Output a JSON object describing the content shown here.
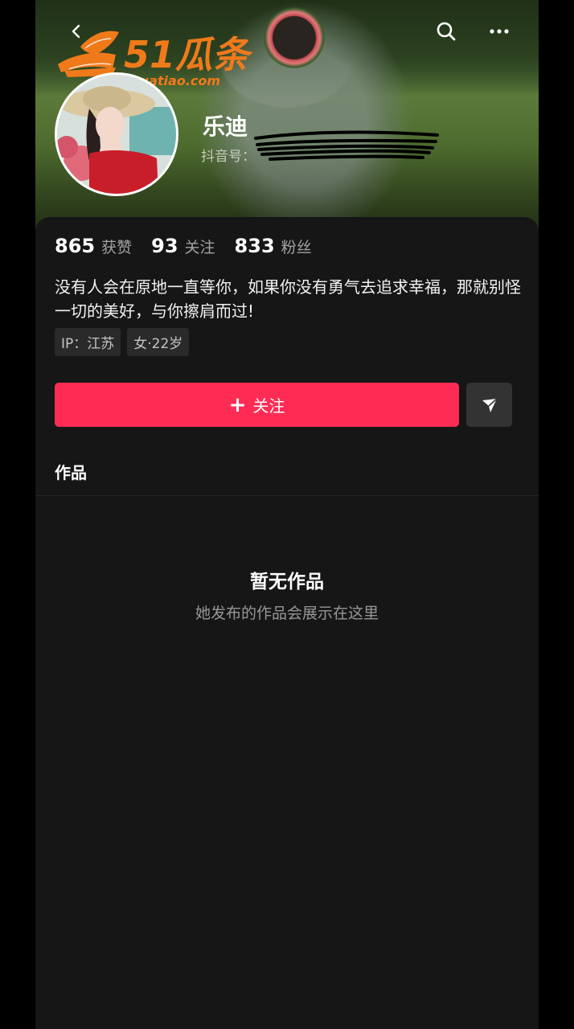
{
  "watermark": {
    "brand": "51瓜条",
    "domain": "51guatiao.com"
  },
  "profile": {
    "nickname": "乐迪",
    "douyin_id_label": "抖音号："
  },
  "stats": [
    {
      "value": "865",
      "label": "获赞"
    },
    {
      "value": "93",
      "label": "关注"
    },
    {
      "value": "833",
      "label": "粉丝"
    }
  ],
  "bio": "没有人会在原地一直等你，如果你没有勇气去追求幸福，那就别怪一切的美好，与你擦肩而过!",
  "tags": [
    "IP：江苏",
    "女·22岁"
  ],
  "actions": {
    "follow_label": "关注",
    "follow_icon": "plus-icon",
    "share_icon": "send-icon"
  },
  "tabs": {
    "works": "作品"
  },
  "empty_state": {
    "title": "暂无作品",
    "subtitle": "她发布的作品会展示在这里"
  },
  "colors": {
    "accent": "#fe2c55",
    "background": "#161616",
    "logo": "#f07a1a"
  }
}
